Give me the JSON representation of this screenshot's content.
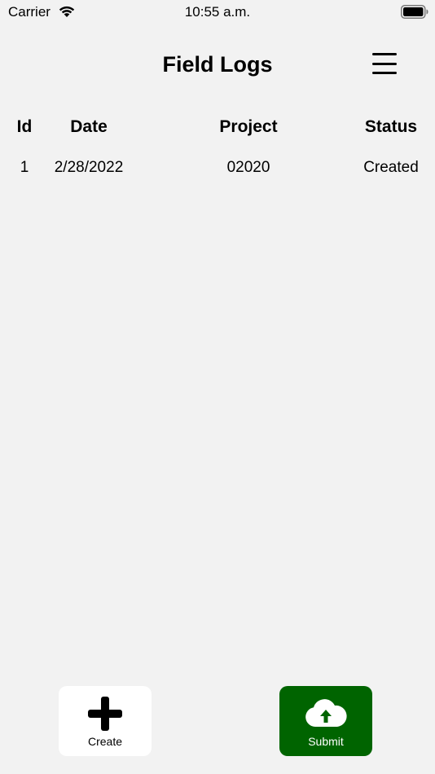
{
  "status_bar": {
    "carrier": "Carrier",
    "time": "10:55 a.m."
  },
  "header": {
    "title": "Field Logs"
  },
  "table": {
    "columns": [
      "Id",
      "Date",
      "Project",
      "Status"
    ],
    "rows": [
      {
        "id": "1",
        "date": "2/28/2022",
        "project": "02020",
        "status": "Created"
      }
    ]
  },
  "actions": {
    "create_label": "Create",
    "submit_label": "Submit"
  },
  "colors": {
    "background": "#f2f2f2",
    "submit_bg": "#006400",
    "create_bg": "#ffffff"
  }
}
